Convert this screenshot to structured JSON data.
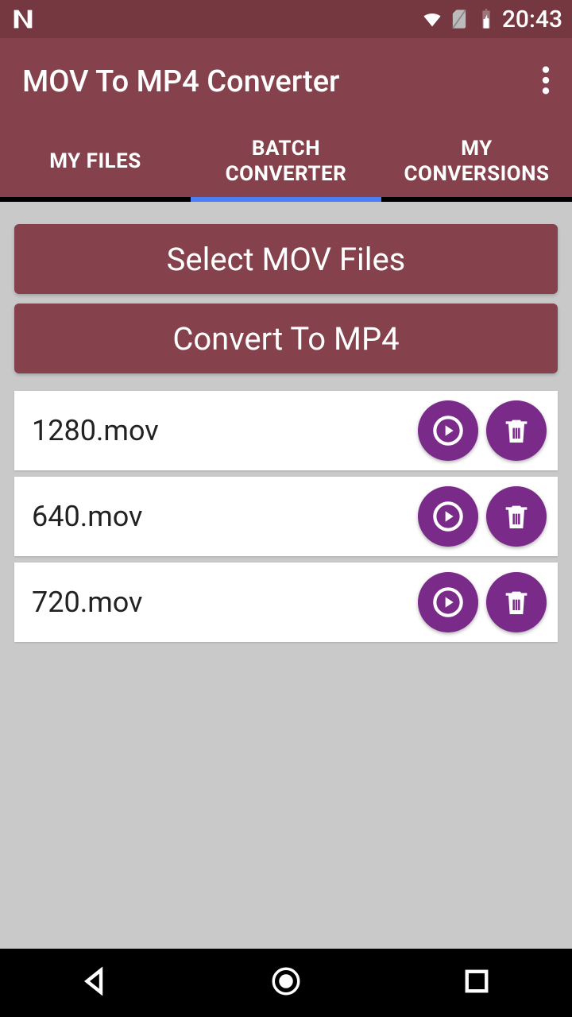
{
  "statusbar": {
    "time": "20:43"
  },
  "appbar": {
    "title": "MOV To MP4 Converter"
  },
  "tabs": [
    {
      "label": "MY FILES",
      "active": false
    },
    {
      "label": "BATCH CONVERTER",
      "active": true
    },
    {
      "label": "MY CONVERSIONS",
      "active": false
    }
  ],
  "buttons": {
    "select": "Select MOV Files",
    "convert": "Convert To MP4"
  },
  "files": [
    {
      "name": "1280.mov"
    },
    {
      "name": "640.mov"
    },
    {
      "name": "720.mov"
    }
  ]
}
